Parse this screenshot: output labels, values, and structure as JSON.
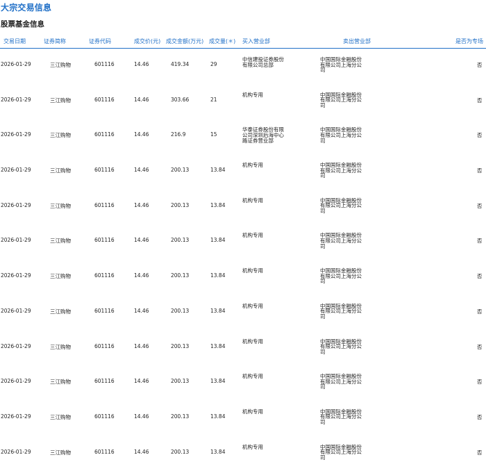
{
  "page_title": "大宗交易信息",
  "section_title": "股票基金信息",
  "columns": {
    "date": "交易日期",
    "name": "证券简称",
    "code": "证券代码",
    "price": "成交价(元)",
    "amount": "成交金额(万元)",
    "volume": "成交量(＊)",
    "buyer": "买入营业部",
    "seller": "卖出营业部",
    "flag": "是否为专场"
  },
  "rows": [
    {
      "date": "2026-01-29",
      "name": "三江购物",
      "code": "601116",
      "price": "14.46",
      "amount": "419.34",
      "volume": "29",
      "buyer": "中信建投证券股份有限公司总部",
      "seller": "中国国际金融股份有限公司上海分公司",
      "flag": "否"
    },
    {
      "date": "2026-01-29",
      "name": "三江购物",
      "code": "601116",
      "price": "14.46",
      "amount": "303.66",
      "volume": "21",
      "buyer": "机构专用",
      "seller": "中国国际金融股份有限公司上海分公司",
      "flag": "否"
    },
    {
      "date": "2026-01-29",
      "name": "三江购物",
      "code": "601116",
      "price": "14.46",
      "amount": "216.9",
      "volume": "15",
      "buyer": "华泰证券股份有限公司深圳后海中心路证券营业部",
      "seller": "中国国际金融股份有限公司上海分公司",
      "flag": "否"
    },
    {
      "date": "2026-01-29",
      "name": "三江购物",
      "code": "601116",
      "price": "14.46",
      "amount": "200.13",
      "volume": "13.84",
      "buyer": "机构专用",
      "seller": "中国国际金融股份有限公司上海分公司",
      "flag": "否"
    },
    {
      "date": "2026-01-29",
      "name": "三江购物",
      "code": "601116",
      "price": "14.46",
      "amount": "200.13",
      "volume": "13.84",
      "buyer": "机构专用",
      "seller": "中国国际金融股份有限公司上海分公司",
      "flag": "否"
    },
    {
      "date": "2026-01-29",
      "name": "三江购物",
      "code": "601116",
      "price": "14.46",
      "amount": "200.13",
      "volume": "13.84",
      "buyer": "机构专用",
      "seller": "中国国际金融股份有限公司上海分公司",
      "flag": "否"
    },
    {
      "date": "2026-01-29",
      "name": "三江购物",
      "code": "601116",
      "price": "14.46",
      "amount": "200.13",
      "volume": "13.84",
      "buyer": "机构专用",
      "seller": "中国国际金融股份有限公司上海分公司",
      "flag": "否"
    },
    {
      "date": "2026-01-29",
      "name": "三江购物",
      "code": "601116",
      "price": "14.46",
      "amount": "200.13",
      "volume": "13.84",
      "buyer": "机构专用",
      "seller": "中国国际金融股份有限公司上海分公司",
      "flag": "否"
    },
    {
      "date": "2026-01-29",
      "name": "三江购物",
      "code": "601116",
      "price": "14.46",
      "amount": "200.13",
      "volume": "13.84",
      "buyer": "机构专用",
      "seller": "中国国际金融股份有限公司上海分公司",
      "flag": "否"
    },
    {
      "date": "2026-01-29",
      "name": "三江购物",
      "code": "601116",
      "price": "14.46",
      "amount": "200.13",
      "volume": "13.84",
      "buyer": "机构专用",
      "seller": "中国国际金融股份有限公司上海分公司",
      "flag": "否"
    },
    {
      "date": "2026-01-29",
      "name": "三江购物",
      "code": "601116",
      "price": "14.46",
      "amount": "200.13",
      "volume": "13.84",
      "buyer": "机构专用",
      "seller": "中国国际金融股份有限公司上海分公司",
      "flag": "否"
    },
    {
      "date": "2026-01-29",
      "name": "三江购物",
      "code": "601116",
      "price": "14.46",
      "amount": "200.13",
      "volume": "13.84",
      "buyer": "机构专用",
      "seller": "中国国际金融股份有限公司上海分公司",
      "flag": "否"
    }
  ],
  "colors": {
    "accent": "#1f6fc7",
    "text": "#222222"
  }
}
